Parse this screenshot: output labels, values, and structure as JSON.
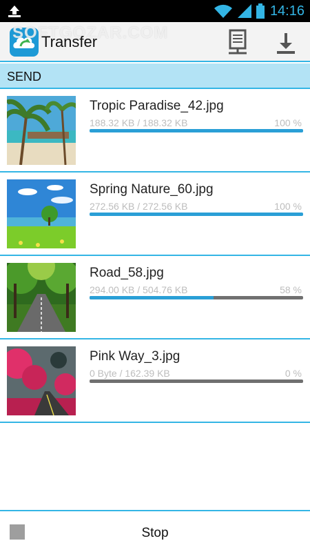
{
  "status_bar": {
    "time": "14:16"
  },
  "action_bar": {
    "title": "Transfer",
    "watermark": "SOFTGOZAR.COM"
  },
  "section": {
    "label": "SEND"
  },
  "transfers": [
    {
      "name": "Tropic Paradise_42.jpg",
      "size": "188.32 KB / 188.32 KB",
      "percent": "100 %",
      "progress": 1.0,
      "thumb": "tropical-beach"
    },
    {
      "name": "Spring Nature_60.jpg",
      "size": "272.56 KB / 272.56 KB",
      "percent": "100 %",
      "progress": 1.0,
      "thumb": "spring-meadow"
    },
    {
      "name": "Road_58.jpg",
      "size": "294.00 KB / 504.76 KB",
      "percent": "58 %",
      "progress": 0.58,
      "thumb": "tree-road"
    },
    {
      "name": "Pink Way_3.jpg",
      "size": "0 Byte / 162.39 KB",
      "percent": "0 %",
      "progress": 0.0,
      "thumb": "pink-trees"
    }
  ],
  "footer": {
    "stop_label": "Stop"
  },
  "colors": {
    "accent": "#33b5e5",
    "section_bg": "#b3e3f5",
    "progress": "#2a9fd6"
  }
}
